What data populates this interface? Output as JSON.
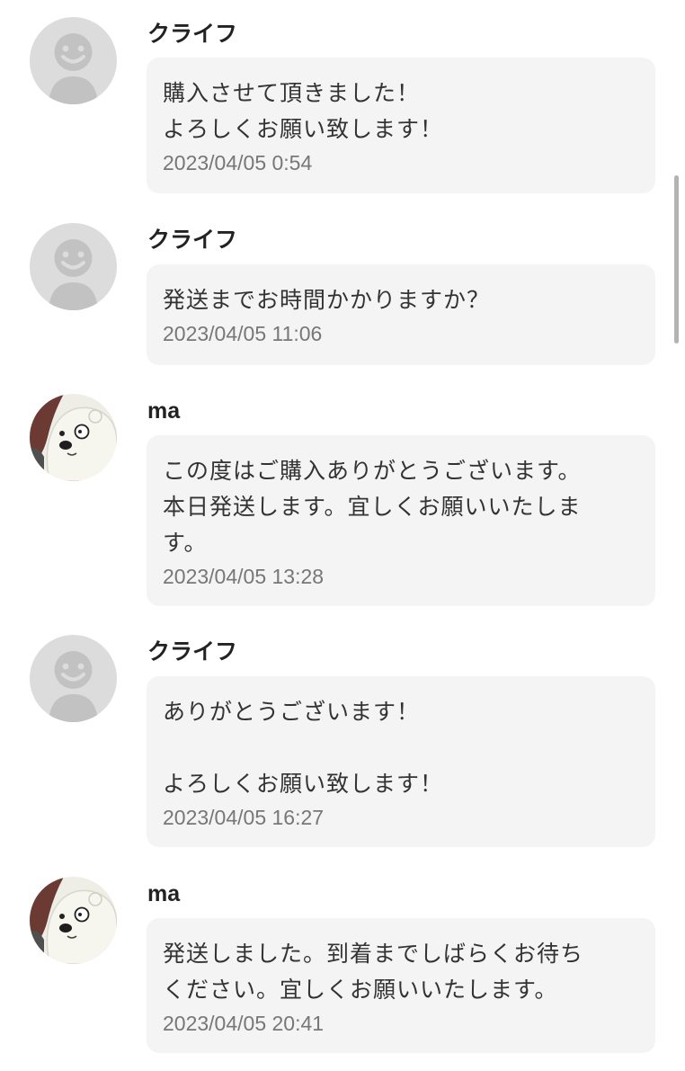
{
  "messages": [
    {
      "sender": "クライフ",
      "avatar": "default-user-icon",
      "text": "購入させて頂きました！\nよろしくお願い致します！",
      "timestamp": "2023/04/05 0:54"
    },
    {
      "sender": "クライフ",
      "avatar": "default-user-icon",
      "text": "発送までお時間かかりますか？",
      "timestamp": "2023/04/05 11:06"
    },
    {
      "sender": "ma",
      "avatar": "polar-bear-avatar",
      "text": "この度はご購入ありがとうございます。\n本日発送します。宜しくお願いいたしま\nす。",
      "timestamp": "2023/04/05 13:28"
    },
    {
      "sender": "クライフ",
      "avatar": "default-user-icon",
      "text": "ありがとうございます！\n\nよろしくお願い致します！",
      "timestamp": "2023/04/05 16:27"
    },
    {
      "sender": "ma",
      "avatar": "polar-bear-avatar",
      "text": "発送しました。到着までしばらくお待ち\nください。宜しくお願いいたします。",
      "timestamp": "2023/04/05 20:41"
    }
  ],
  "colors": {
    "bubble": "#f4f4f4",
    "default_avatar_bg": "#dcdcdc",
    "default_avatar_fg": "#c2c2c2",
    "timestamp": "#777777"
  }
}
